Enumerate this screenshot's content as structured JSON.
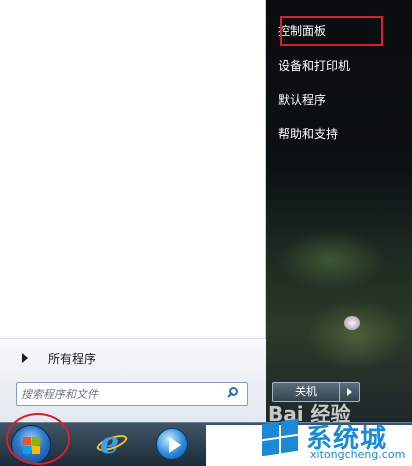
{
  "start_menu": {
    "all_programs_label": "所有程序",
    "search": {
      "placeholder": "搜索程序和文件"
    },
    "right_items": {
      "control_panel": "控制面板",
      "devices_printers": "设备和打印机",
      "default_programs": "默认程序",
      "help_support": "帮助和支持"
    },
    "shutdown_label": "关机"
  },
  "watermark": {
    "baidu": "Bai 经验",
    "site_name": "系统城",
    "site_url": "xitongcheng.com"
  },
  "colors": {
    "highlight": "#d6202c",
    "watermark_blue": "#1a8ad6"
  },
  "taskbar_icons": [
    "windows-start-icon",
    "internet-explorer-icon",
    "media-player-icon"
  ]
}
